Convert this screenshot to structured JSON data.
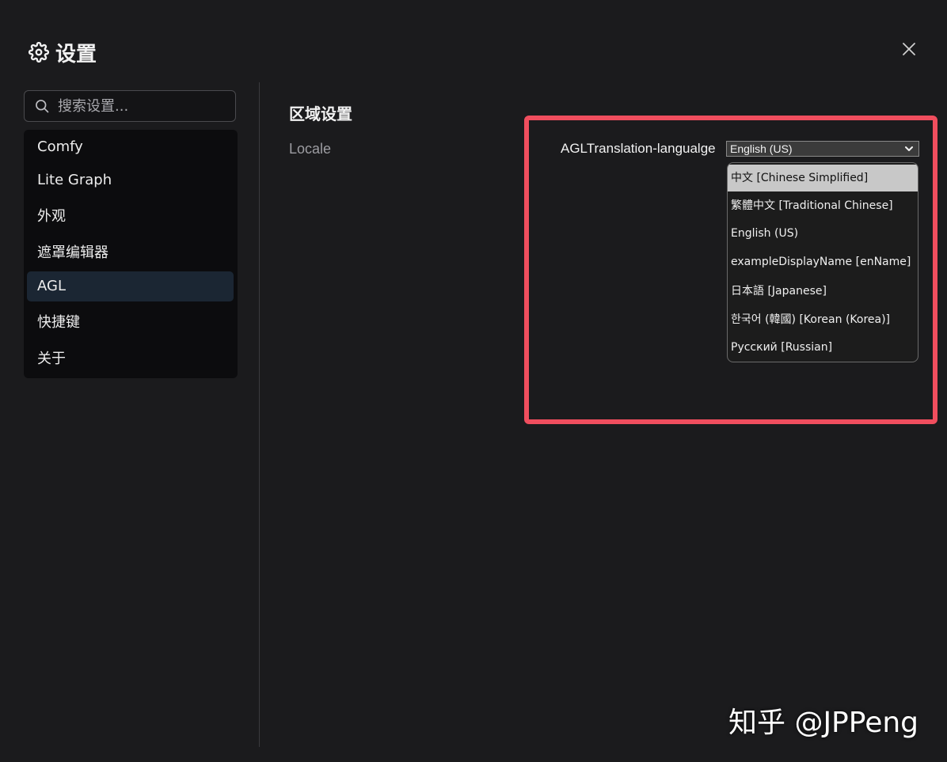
{
  "dialog": {
    "title": "设置",
    "title_icon": "gear-icon",
    "close_icon": "close-icon"
  },
  "search": {
    "placeholder": "搜索设置...",
    "icon": "search-icon"
  },
  "sidebar": {
    "items": [
      {
        "label": "Comfy",
        "active": false
      },
      {
        "label": "Lite Graph",
        "active": false
      },
      {
        "label": "外观",
        "active": false
      },
      {
        "label": "遮罩编辑器",
        "active": false
      },
      {
        "label": "AGL",
        "active": true
      },
      {
        "label": "快捷键",
        "active": false
      },
      {
        "label": "关于",
        "active": false
      }
    ]
  },
  "content": {
    "section_title": "区域设置",
    "setting_label": "Locale",
    "select_label": "AGLTranslation-langualge",
    "select_value": "English (US)",
    "options": [
      {
        "label": "中文 [Chinese Simplified]",
        "highlighted": true
      },
      {
        "label": "繁體中文 [Traditional Chinese]",
        "highlighted": false
      },
      {
        "label": "English (US)",
        "highlighted": false
      },
      {
        "label": "exampleDisplayName [enName]",
        "highlighted": false
      },
      {
        "label": "日本語 [Japanese]",
        "highlighted": false
      },
      {
        "label": "한국어 (韓國) [Korean (Korea)]",
        "highlighted": false
      },
      {
        "label": "Русский [Russian]",
        "highlighted": false
      }
    ]
  },
  "colors": {
    "background": "#1b1b1d",
    "highlight_border": "#f04e5e",
    "active_nav": "#1b2633"
  },
  "watermark": "知乎 @JPPeng"
}
